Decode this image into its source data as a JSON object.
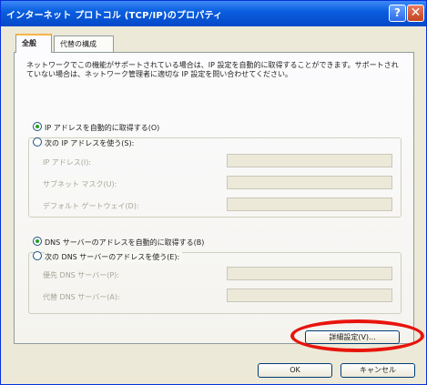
{
  "window": {
    "title": "インターネット プロトコル (TCP/IP)のプロパティ",
    "help_glyph": "?",
    "close_glyph": "✕"
  },
  "tabs": [
    {
      "label": "全般",
      "selected": true
    },
    {
      "label": "代替の構成",
      "selected": false
    }
  ],
  "description": "ネットワークでこの機能がサポートされている場合は、IP 設定を自動的に取得することができます。サポートされていない場合は、ネットワーク管理者に適切な IP 設定を問い合わせてください。",
  "ip": {
    "auto_label": "IP アドレスを自動的に取得する(O)",
    "manual_label": "次の IP アドレスを使う(S):",
    "selected": "auto",
    "fields": [
      {
        "label": "IP アドレス(I):",
        "value": ""
      },
      {
        "label": "サブネット マスク(U):",
        "value": ""
      },
      {
        "label": "デフォルト ゲートウェイ(D):",
        "value": ""
      }
    ]
  },
  "dns": {
    "auto_label": "DNS サーバーのアドレスを自動的に取得する(B)",
    "manual_label": "次の DNS サーバーのアドレスを使う(E):",
    "selected": "auto",
    "fields": [
      {
        "label": "優先 DNS サーバー(P):",
        "value": ""
      },
      {
        "label": "代替 DNS サーバー(A):",
        "value": ""
      }
    ]
  },
  "buttons": {
    "advanced": "詳細設定(V)...",
    "ok": "OK",
    "cancel": "キャンセル"
  },
  "colors": {
    "highlight": "#e8140c",
    "titlebar": "#0548c8"
  }
}
